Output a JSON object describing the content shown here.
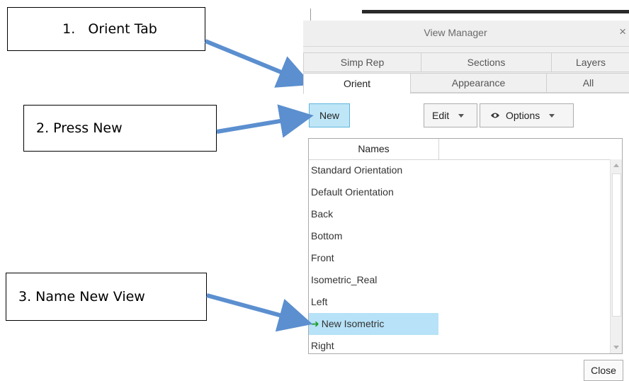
{
  "annotations": {
    "step1": "1.   Orient Tab",
    "step2": "2. Press New",
    "step3": "3. Name New View",
    "arrow_color": "#5b8fcf"
  },
  "dialog": {
    "title": "View Manager",
    "close_glyph": "×",
    "tabs_row1": [
      "Simp Rep",
      "Sections",
      "Layers"
    ],
    "tabs_row2": [
      "Orient",
      "Appearance",
      "All"
    ],
    "active_tab": "Orient",
    "toolbar": {
      "new_label": "New",
      "edit_label": "Edit",
      "options_label": "Options",
      "options_icon": "eye-icon"
    },
    "list": {
      "column_header": "Names",
      "items": [
        "Standard Orientation",
        "Default Orientation",
        "Back",
        "Bottom",
        "Front",
        "Isometric_Real",
        "Left",
        "New Isometric",
        "Right"
      ],
      "selected_item": "New Isometric",
      "selected_marker_icon": "green-arrow-icon",
      "selection_color": "#b7e2f7"
    },
    "close_label": "Close",
    "new_button_color": "#bfe6f7"
  }
}
